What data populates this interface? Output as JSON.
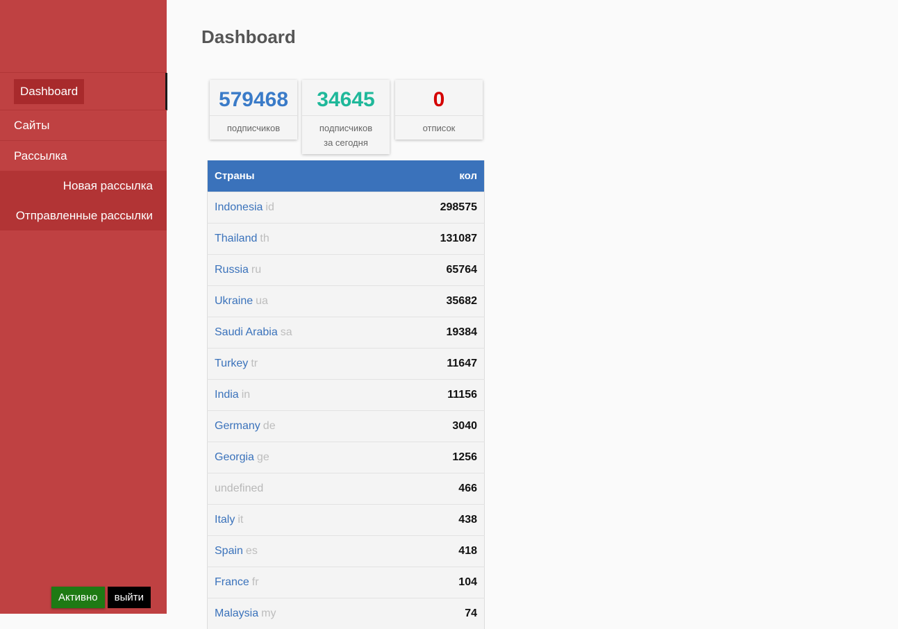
{
  "sidebar": {
    "nav": [
      {
        "label": "Dashboard",
        "active": true
      },
      {
        "label": "Сайты"
      },
      {
        "label": "Рассылка"
      }
    ],
    "subnav": [
      {
        "label": "Новая рассылка"
      },
      {
        "label": "Отправленные рассылки"
      }
    ],
    "status_label": "Активно",
    "logout_label": "выйти"
  },
  "page": {
    "title": "Dashboard"
  },
  "stats": [
    {
      "value": "579468",
      "label_line1": "подписчиков",
      "label_line2": "",
      "color": "#3a7bc8"
    },
    {
      "value": "34645",
      "label_line1": "подписчиков",
      "label_line2": "за сегодня",
      "color": "#1fb89a"
    },
    {
      "value": "0",
      "label_line1": "отписок",
      "label_line2": "",
      "color": "#d40000"
    }
  ],
  "table": {
    "headers": {
      "country": "Страны",
      "count": "кол"
    },
    "rows": [
      {
        "name": "Indonesia",
        "code": "id",
        "count": "298575"
      },
      {
        "name": "Thailand",
        "code": "th",
        "count": "131087"
      },
      {
        "name": "Russia",
        "code": "ru",
        "count": "65764"
      },
      {
        "name": "Ukraine",
        "code": "ua",
        "count": "35682"
      },
      {
        "name": "Saudi Arabia",
        "code": "sa",
        "count": "19384"
      },
      {
        "name": "Turkey",
        "code": "tr",
        "count": "11647"
      },
      {
        "name": "India",
        "code": "in",
        "count": "11156"
      },
      {
        "name": "Germany",
        "code": "de",
        "count": "3040"
      },
      {
        "name": "Georgia",
        "code": "ge",
        "count": "1256"
      },
      {
        "name": "undefined",
        "code": "",
        "count": "466"
      },
      {
        "name": "Italy",
        "code": "it",
        "count": "438"
      },
      {
        "name": "Spain",
        "code": "es",
        "count": "418"
      },
      {
        "name": "France",
        "code": "fr",
        "count": "104"
      },
      {
        "name": "Malaysia",
        "code": "my",
        "count": "74"
      }
    ]
  }
}
